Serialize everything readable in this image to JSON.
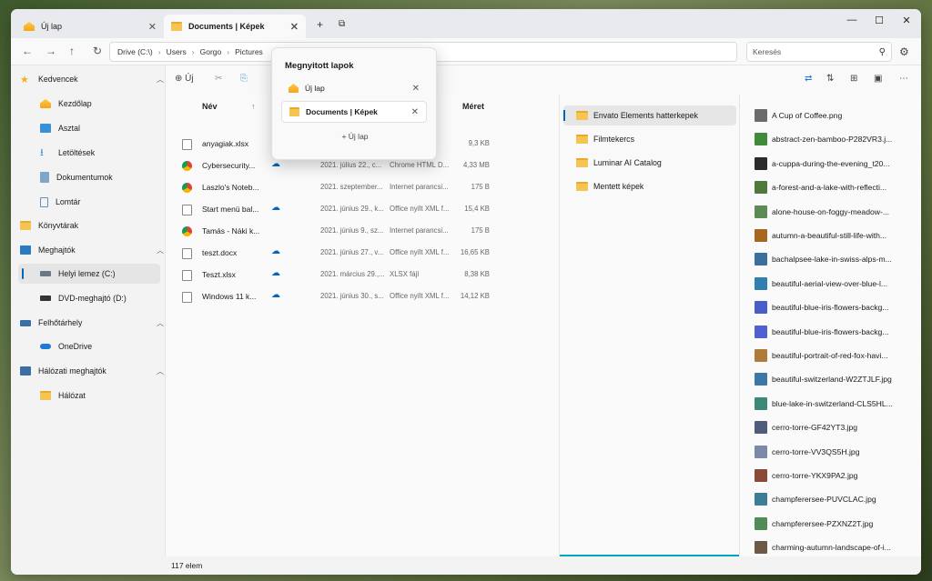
{
  "tabs": [
    {
      "label": "Új lap"
    },
    {
      "label": "Documents | Képek"
    }
  ],
  "tab_add": "+",
  "tab_overview": "⧉",
  "address": {
    "crumbs": [
      "Drive (C:\\)",
      "Users",
      "Gorgo",
      "Pictures"
    ],
    "search_placeholder": "Keresés"
  },
  "sidebar": {
    "items": [
      {
        "label": "Kedvencek",
        "icon": "star-icon"
      },
      {
        "label": "Kezdőlap",
        "icon": "home-icon"
      },
      {
        "label": "Asztal",
        "icon": "desktop-icon"
      },
      {
        "label": "Letöltések",
        "icon": "download-icon"
      },
      {
        "label": "Dokumentumok",
        "icon": "documents-icon"
      },
      {
        "label": "Lomtár",
        "icon": "recycle-bin-icon"
      },
      {
        "label": "Könyvtárak",
        "icon": "folder-icon"
      },
      {
        "label": "Meghajtók",
        "icon": "computer-icon"
      },
      {
        "label": "Helyi lemez (C:)",
        "icon": "drive-icon"
      },
      {
        "label": "DVD-meghajtó (D:)",
        "icon": "dvd-icon"
      },
      {
        "label": "Felhőtárhely",
        "icon": "cloud-storage-icon"
      },
      {
        "label": "OneDrive",
        "icon": "onedrive-icon"
      },
      {
        "label": "Hálózati meghajtók",
        "icon": "network-drive-icon"
      },
      {
        "label": "Hálózat",
        "icon": "folder-icon"
      }
    ]
  },
  "toolbar": {
    "new_label": "Új"
  },
  "columns": {
    "name": "Név",
    "size": "Méret"
  },
  "files": [
    {
      "name": "anyagiak.xlsx",
      "cloud": false,
      "date": "",
      "type": "",
      "size": "9,3 KB",
      "icon": "excel-file-icon"
    },
    {
      "name": "Cybersecurity...",
      "cloud": true,
      "date": "2021. július 22., c...",
      "type": "Chrome HTML D...",
      "size": "4,33 MB",
      "icon": "chrome-icon"
    },
    {
      "name": "Laszlo's Noteb...",
      "cloud": false,
      "date": "2021. szeptember...",
      "type": "Internet parancsi...",
      "size": "175 B",
      "icon": "chrome-shortcut-icon"
    },
    {
      "name": "Start menü bal...",
      "cloud": true,
      "date": "2021. június 29., k...",
      "type": "Office nyílt XML f...",
      "size": "15,4 KB",
      "icon": "document-icon"
    },
    {
      "name": "Tamás - Náki k...",
      "cloud": false,
      "date": "2021. június 9., sz...",
      "type": "Internet parancsi...",
      "size": "175 B",
      "icon": "chrome-shortcut-icon"
    },
    {
      "name": "teszt.docx",
      "cloud": true,
      "date": "2021. június 27., v...",
      "type": "Office nyílt XML f...",
      "size": "16,65 KB",
      "icon": "document-icon"
    },
    {
      "name": "Teszt.xlsx",
      "cloud": true,
      "date": "2021. március 29.,...",
      "type": "XLSX fájl",
      "size": "8,38 KB",
      "icon": "document-icon"
    },
    {
      "name": "Windows 11 k...",
      "cloud": true,
      "date": "2021. június 30., s...",
      "type": "Office nyílt XML f...",
      "size": "14,12 KB",
      "icon": "document-icon"
    }
  ],
  "folders": [
    {
      "label": "Envato Elements hatterkepek",
      "selected": true
    },
    {
      "label": "Filmtekercs",
      "selected": false
    },
    {
      "label": "Luminar AI Catalog",
      "selected": false
    },
    {
      "label": "Mentett képek",
      "selected": false
    }
  ],
  "images": [
    {
      "name": "A Cup of Coffee.png",
      "color": "#6b6b6b"
    },
    {
      "name": "abstract-zen-bamboo-P282VR3.j...",
      "color": "#3f8b3a"
    },
    {
      "name": "a-cuppa-during-the-evening_t20...",
      "color": "#2b2b2b"
    },
    {
      "name": "a-forest-and-a-lake-with-reflecti...",
      "color": "#4f7a3c"
    },
    {
      "name": "alone-house-on-foggy-meadow-...",
      "color": "#5e8b55"
    },
    {
      "name": "autumn-a-beautiful-still-life-with...",
      "color": "#a8651e"
    },
    {
      "name": "bachalpsee-lake-in-swiss-alps-m...",
      "color": "#3a6f9e"
    },
    {
      "name": "beautiful-aerial-view-over-blue-l...",
      "color": "#2f7fb0"
    },
    {
      "name": "beautiful-blue-iris-flowers-backg...",
      "color": "#4a5ec9"
    },
    {
      "name": "beautiful-blue-iris-flowers-backg...",
      "color": "#5160d1"
    },
    {
      "name": "beautiful-portrait-of-red-fox-havi...",
      "color": "#b07a3a"
    },
    {
      "name": "beautiful-switzerland-W2ZTJLF.jpg",
      "color": "#3b78a8"
    },
    {
      "name": "blue-lake-in-switzerland-CLS5HL...",
      "color": "#3a8a77"
    },
    {
      "name": "cerro-torre-GF42YT3.jpg",
      "color": "#4d5d7a"
    },
    {
      "name": "cerro-torre-VV3QS5H.jpg",
      "color": "#7a8aa8"
    },
    {
      "name": "cerro-torre-YKX9PA2.jpg",
      "color": "#8a4a3a"
    },
    {
      "name": "champferersee-PUVCLAC.jpg",
      "color": "#3d7e96"
    },
    {
      "name": "champferersee-PZXNZ2T.jpg",
      "color": "#4e8c5a"
    },
    {
      "name": "charming-autumn-landscape-of-i...",
      "color": "#6e5a44"
    }
  ],
  "status": {
    "count": "117 elem"
  },
  "popup": {
    "title": "Megnyitott lapok",
    "tabs": [
      {
        "label": "Új lap",
        "selected": false
      },
      {
        "label": "Documents | Képek",
        "selected": true
      }
    ],
    "new_tab": "Új lap"
  }
}
